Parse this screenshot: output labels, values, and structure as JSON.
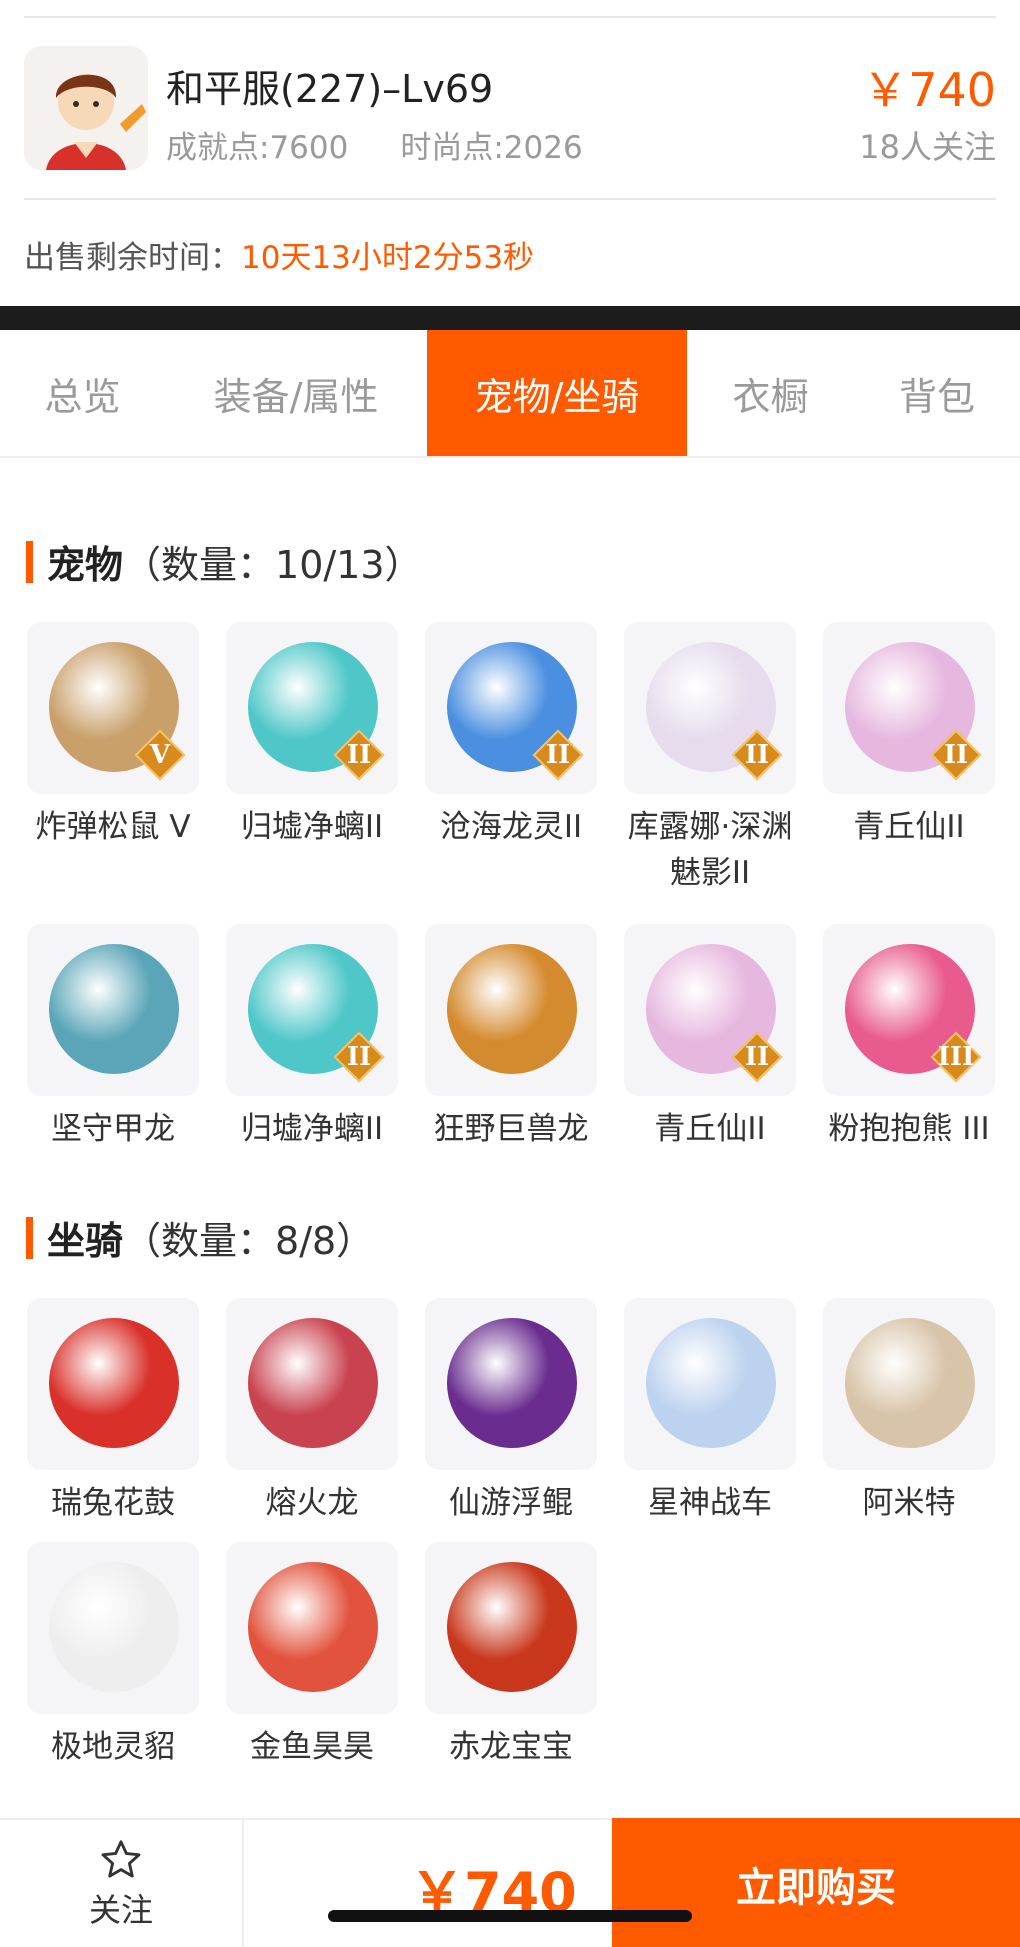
{
  "account": {
    "title": "和平服(227)–Lv69",
    "achievement": "成就点:7600",
    "fashion": "时尚点:2026",
    "price": "￥740",
    "followers": "18人关注"
  },
  "sale": {
    "label": "出售剩余时间：",
    "remaining": "10天13小时2分53秒"
  },
  "tabs": [
    {
      "label": "总览",
      "active": false
    },
    {
      "label": "装备/属性",
      "active": false
    },
    {
      "label": "宠物/坐骑",
      "active": true
    },
    {
      "label": "衣橱",
      "active": false
    },
    {
      "label": "背包",
      "active": false
    }
  ],
  "pets": {
    "name": "宠物",
    "count": "（数量：10/13）",
    "items": [
      {
        "label": "炸弹松鼠 V",
        "badge": "V",
        "color": "#c9a06a"
      },
      {
        "label": "归墟净螭II",
        "badge": "II",
        "color": "#4fc7c9"
      },
      {
        "label": "沧海龙灵II",
        "badge": "II",
        "color": "#4a8fe0"
      },
      {
        "label": "库露娜·深渊魅影II",
        "badge": "II",
        "color": "#e6dced"
      },
      {
        "label": "青丘仙II",
        "badge": "II",
        "color": "#e7b8df"
      },
      {
        "label": "坚守甲龙",
        "badge": "",
        "color": "#5aa6b8"
      },
      {
        "label": "归墟净螭II",
        "badge": "II",
        "color": "#4fc7c9"
      },
      {
        "label": "狂野巨兽龙",
        "badge": "",
        "color": "#d48a2e"
      },
      {
        "label": "青丘仙II",
        "badge": "II",
        "color": "#e7b8df"
      },
      {
        "label": "粉抱抱熊 III",
        "badge": "III",
        "color": "#e85b8c"
      }
    ]
  },
  "mounts": {
    "name": "坐骑",
    "count": "（数量：8/8）",
    "items": [
      {
        "label": "瑞兔花鼓",
        "color": "#d9302a"
      },
      {
        "label": "熔火龙",
        "color": "#c9424f"
      },
      {
        "label": "仙游浮鲲",
        "color": "#6a2d8f"
      },
      {
        "label": "星神战车",
        "color": "#bcd2ee"
      },
      {
        "label": "阿米特",
        "color": "#d8c4a8"
      },
      {
        "label": "极地灵貂",
        "color": "#eeeeee"
      },
      {
        "label": "金鱼昊昊",
        "color": "#e2533d"
      },
      {
        "label": "赤龙宝宝",
        "color": "#c9381c"
      }
    ]
  },
  "bottom": {
    "follow": "关注",
    "price": "￥740",
    "buy": "立即购买"
  }
}
